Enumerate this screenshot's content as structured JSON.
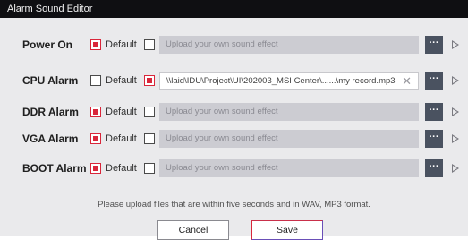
{
  "window": {
    "title": "Alarm Sound Editor"
  },
  "default_label": "Default",
  "placeholder": "Upload your own sound effect",
  "alarms": [
    {
      "label": "Power On",
      "default_checked": true,
      "upload_checked": false,
      "value": ""
    },
    {
      "label": "CPU Alarm",
      "default_checked": false,
      "upload_checked": true,
      "value": "\\\\laid\\IDU\\Project\\UI\\202003_MSI Center\\......\\my record.mp3"
    },
    {
      "label": "DDR Alarm",
      "default_checked": true,
      "upload_checked": false,
      "value": ""
    },
    {
      "label": "VGA Alarm",
      "default_checked": true,
      "upload_checked": false,
      "value": ""
    },
    {
      "label": "BOOT Alarm",
      "default_checked": true,
      "upload_checked": false,
      "value": ""
    }
  ],
  "browse_label": "···",
  "clear_symbol": "✕",
  "note": "Please upload files that are within five seconds and in WAV, MP3 format.",
  "buttons": {
    "cancel": "Cancel",
    "save": "Save"
  },
  "colors": {
    "accent": "#d9263a",
    "titlebar": "#0f0f12",
    "panel": "#eaeaec",
    "browse": "#4a5260"
  }
}
